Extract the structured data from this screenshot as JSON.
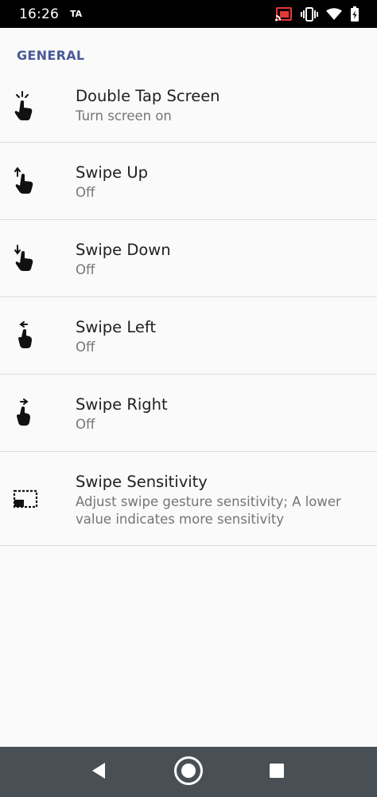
{
  "status_bar": {
    "time": "16:26",
    "carrier": "TA",
    "icons": [
      "cast-icon",
      "vibrate-icon",
      "wifi-icon",
      "battery-icon"
    ]
  },
  "section": {
    "header": "GENERAL"
  },
  "items": [
    {
      "icon": "double-tap-gesture-icon",
      "title": "Double Tap Screen",
      "summary": "Turn screen on"
    },
    {
      "icon": "swipe-up-gesture-icon",
      "title": "Swipe Up",
      "summary": "Off"
    },
    {
      "icon": "swipe-down-gesture-icon",
      "title": "Swipe Down",
      "summary": "Off"
    },
    {
      "icon": "swipe-left-gesture-icon",
      "title": "Swipe Left",
      "summary": "Off"
    },
    {
      "icon": "swipe-right-gesture-icon",
      "title": "Swipe Right",
      "summary": "Off"
    },
    {
      "icon": "sensitivity-icon",
      "title": "Swipe Sensitivity",
      "summary": "Adjust swipe gesture sensitivity; A lower value indicates more sensitivity"
    }
  ],
  "nav_bar": {
    "buttons": [
      "back-icon",
      "home-icon",
      "recents-icon"
    ]
  },
  "colors": {
    "accent": "#4a5a98",
    "status_bar": "#000000",
    "nav_bar": "#495055",
    "background": "#fafafa"
  }
}
